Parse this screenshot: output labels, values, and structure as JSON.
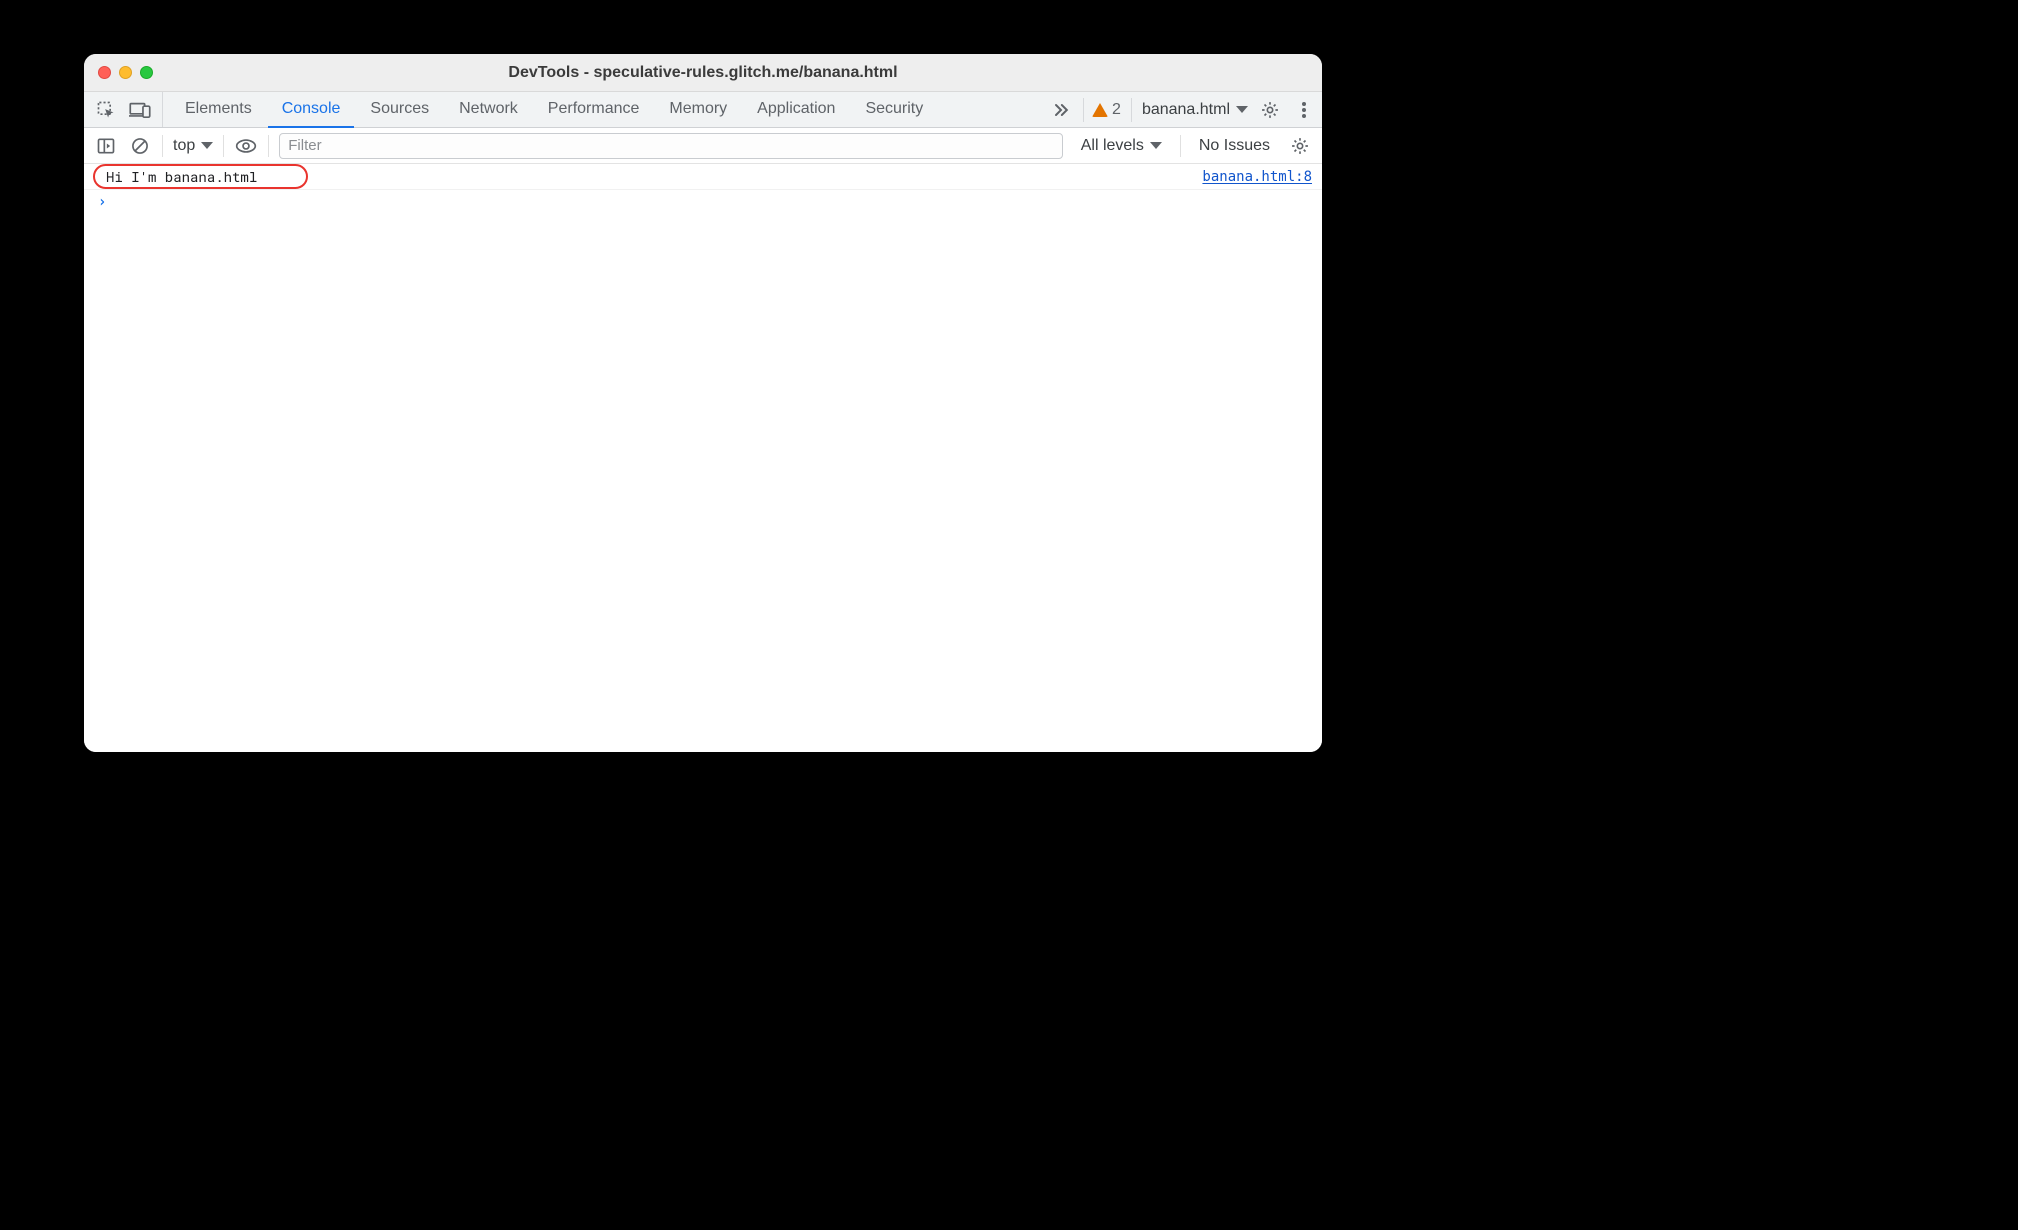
{
  "window": {
    "title": "DevTools - speculative-rules.glitch.me/banana.html"
  },
  "tabs": {
    "items": [
      "Elements",
      "Console",
      "Sources",
      "Network",
      "Performance",
      "Memory",
      "Application",
      "Security"
    ],
    "active_index": 1
  },
  "tabs_right": {
    "warning_count": "2",
    "target_label": "banana.html"
  },
  "toolbar": {
    "context_label": "top",
    "filter_placeholder": "Filter",
    "levels_label": "All levels",
    "issues_label": "No Issues"
  },
  "console": {
    "log_message": "Hi I'm banana.html",
    "source_link": "banana.html:8",
    "prompt": "›"
  },
  "annotation": {
    "color": "#E9342E"
  }
}
